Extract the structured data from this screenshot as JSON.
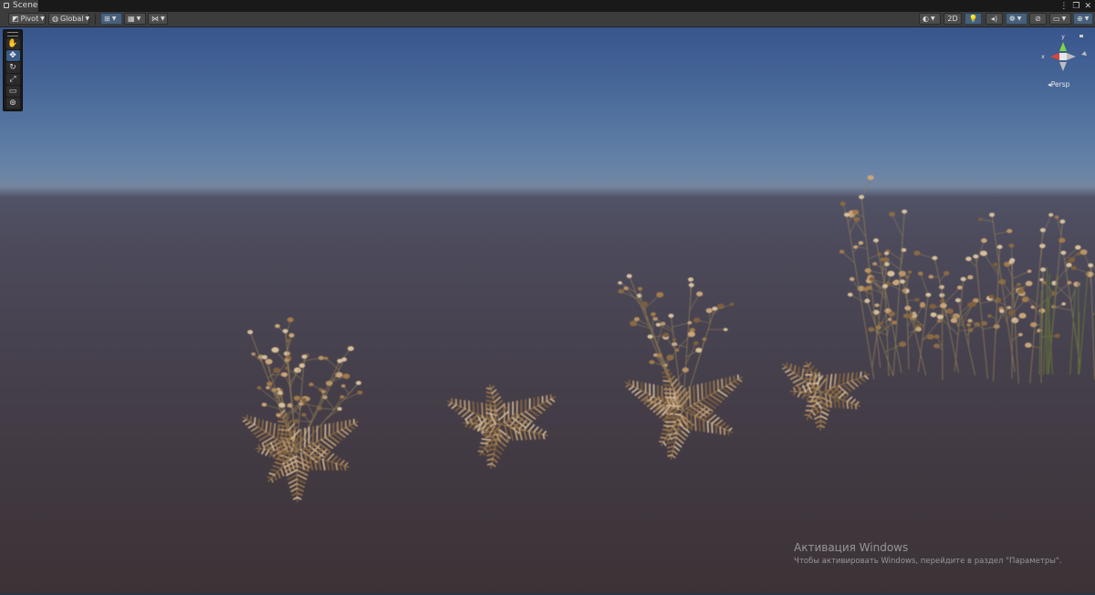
{
  "tab": {
    "label": "Scene",
    "icon": "scene-grid-icon"
  },
  "window_controls": {
    "more": "⋮",
    "maximize": "❐",
    "close": "✕"
  },
  "toolbar": {
    "pivot_label": "Pivot",
    "global_label": "Global",
    "twod_label": "2D"
  },
  "tools": [
    "hand-tool",
    "move-tool",
    "rotate-tool",
    "scale-tool",
    "rect-tool",
    "transform-tool"
  ],
  "gizmo": {
    "y_label": "y",
    "x_label": "x",
    "mode_label": "Persp"
  },
  "watermark": {
    "title": "Активация Windows",
    "subtitle": "Чтобы активировать Windows, перейдите в раздел \"Параметры\"."
  },
  "colors": {
    "sky_top": "#38558c",
    "horizon": "#7486a0",
    "ground": "#3c3336",
    "accent": "#46607c",
    "axis_x": "#d9443b",
    "axis_y": "#7dd646"
  }
}
